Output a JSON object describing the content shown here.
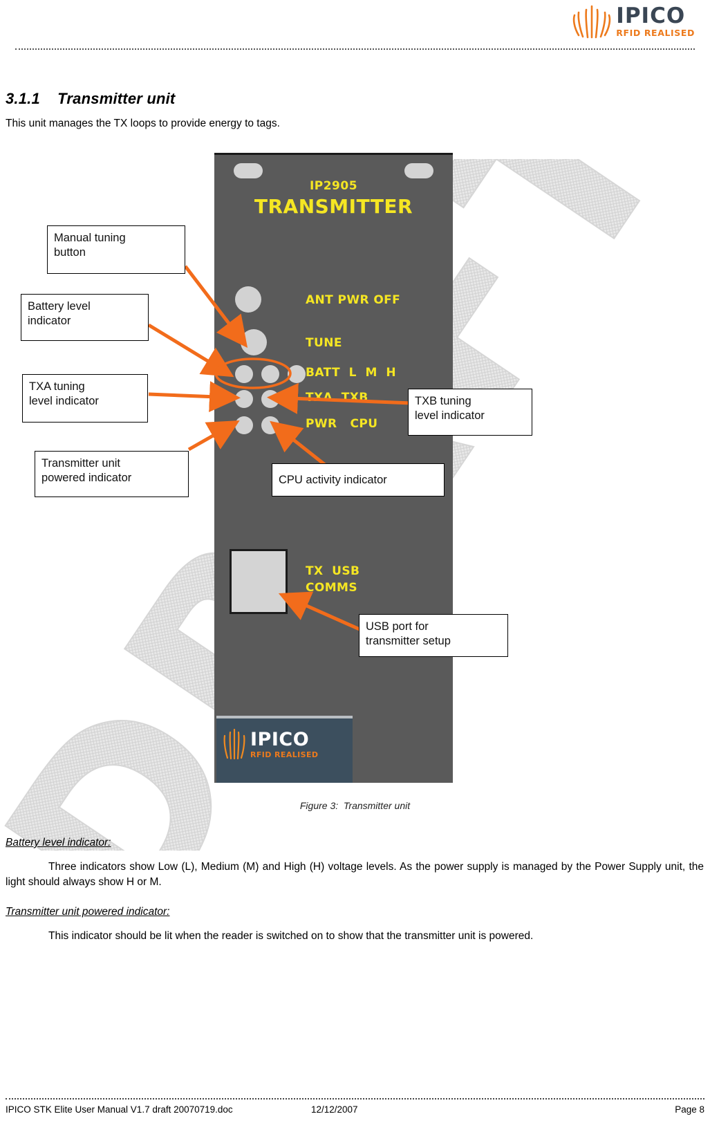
{
  "header": {
    "logo_name": "IPICO",
    "logo_tagline": "RFID REALISED"
  },
  "watermark": {
    "text": "DRAFT"
  },
  "section": {
    "heading": "3.1.1    Transmitter unit",
    "intro": "This unit manages the TX loops to provide energy to tags."
  },
  "device": {
    "model": "IP2905",
    "title": "TRANSMITTER",
    "labels": {
      "ant_pwr_off": "ANT PWR OFF",
      "tune": "TUNE",
      "batt": "BATT  L  M  H",
      "txa_txb": "TXA  TXB",
      "pwr_cpu": "PWR   CPU",
      "tx_usb": "TX  USB",
      "comms": "COMMS"
    },
    "plate": {
      "name": "IPICO",
      "tagline": "RFID REALISED"
    }
  },
  "callouts": [
    {
      "id": "manual-tuning-button",
      "text": "Manual tuning\nbutton"
    },
    {
      "id": "battery-level-indicator",
      "text": "Battery level\nindicator"
    },
    {
      "id": "txa-tuning-level-indicator",
      "text": "TXA tuning\nlevel indicator"
    },
    {
      "id": "transmitter-unit-powered",
      "text": "Transmitter unit\npowered indicator"
    },
    {
      "id": "txb-tuning-level-indicator",
      "text": "TXB tuning\nlevel indicator"
    },
    {
      "id": "cpu-activity-indicator",
      "text": "CPU activity indicator"
    },
    {
      "id": "usb-port-for-setup",
      "text": "USB port for\ntransmitter setup"
    }
  ],
  "figure": {
    "caption": "Figure 3:  Transmitter unit"
  },
  "content": {
    "battery_heading": "Battery level indicator:",
    "battery_body": "Three indicators show Low (L), Medium (M) and High (H) voltage levels. As the power supply is managed by the Power Supply unit, the light should always show H or M.",
    "powered_heading": "Transmitter unit powered indicator:",
    "powered_body": "This indicator should be lit when the reader is switched on to show that the transmitter unit is powered."
  },
  "footer": {
    "document": "IPICO STK Elite User Manual V1.7 draft 20070719.doc",
    "date": "12/12/2007",
    "page": "Page 8"
  },
  "colors": {
    "brand_orange": "#ed7a1c",
    "brand_slate": "#3a4654",
    "panel_gray": "#5a5a5a",
    "label_yellow": "#f5e623",
    "arrow_orange": "#f26c1b"
  }
}
